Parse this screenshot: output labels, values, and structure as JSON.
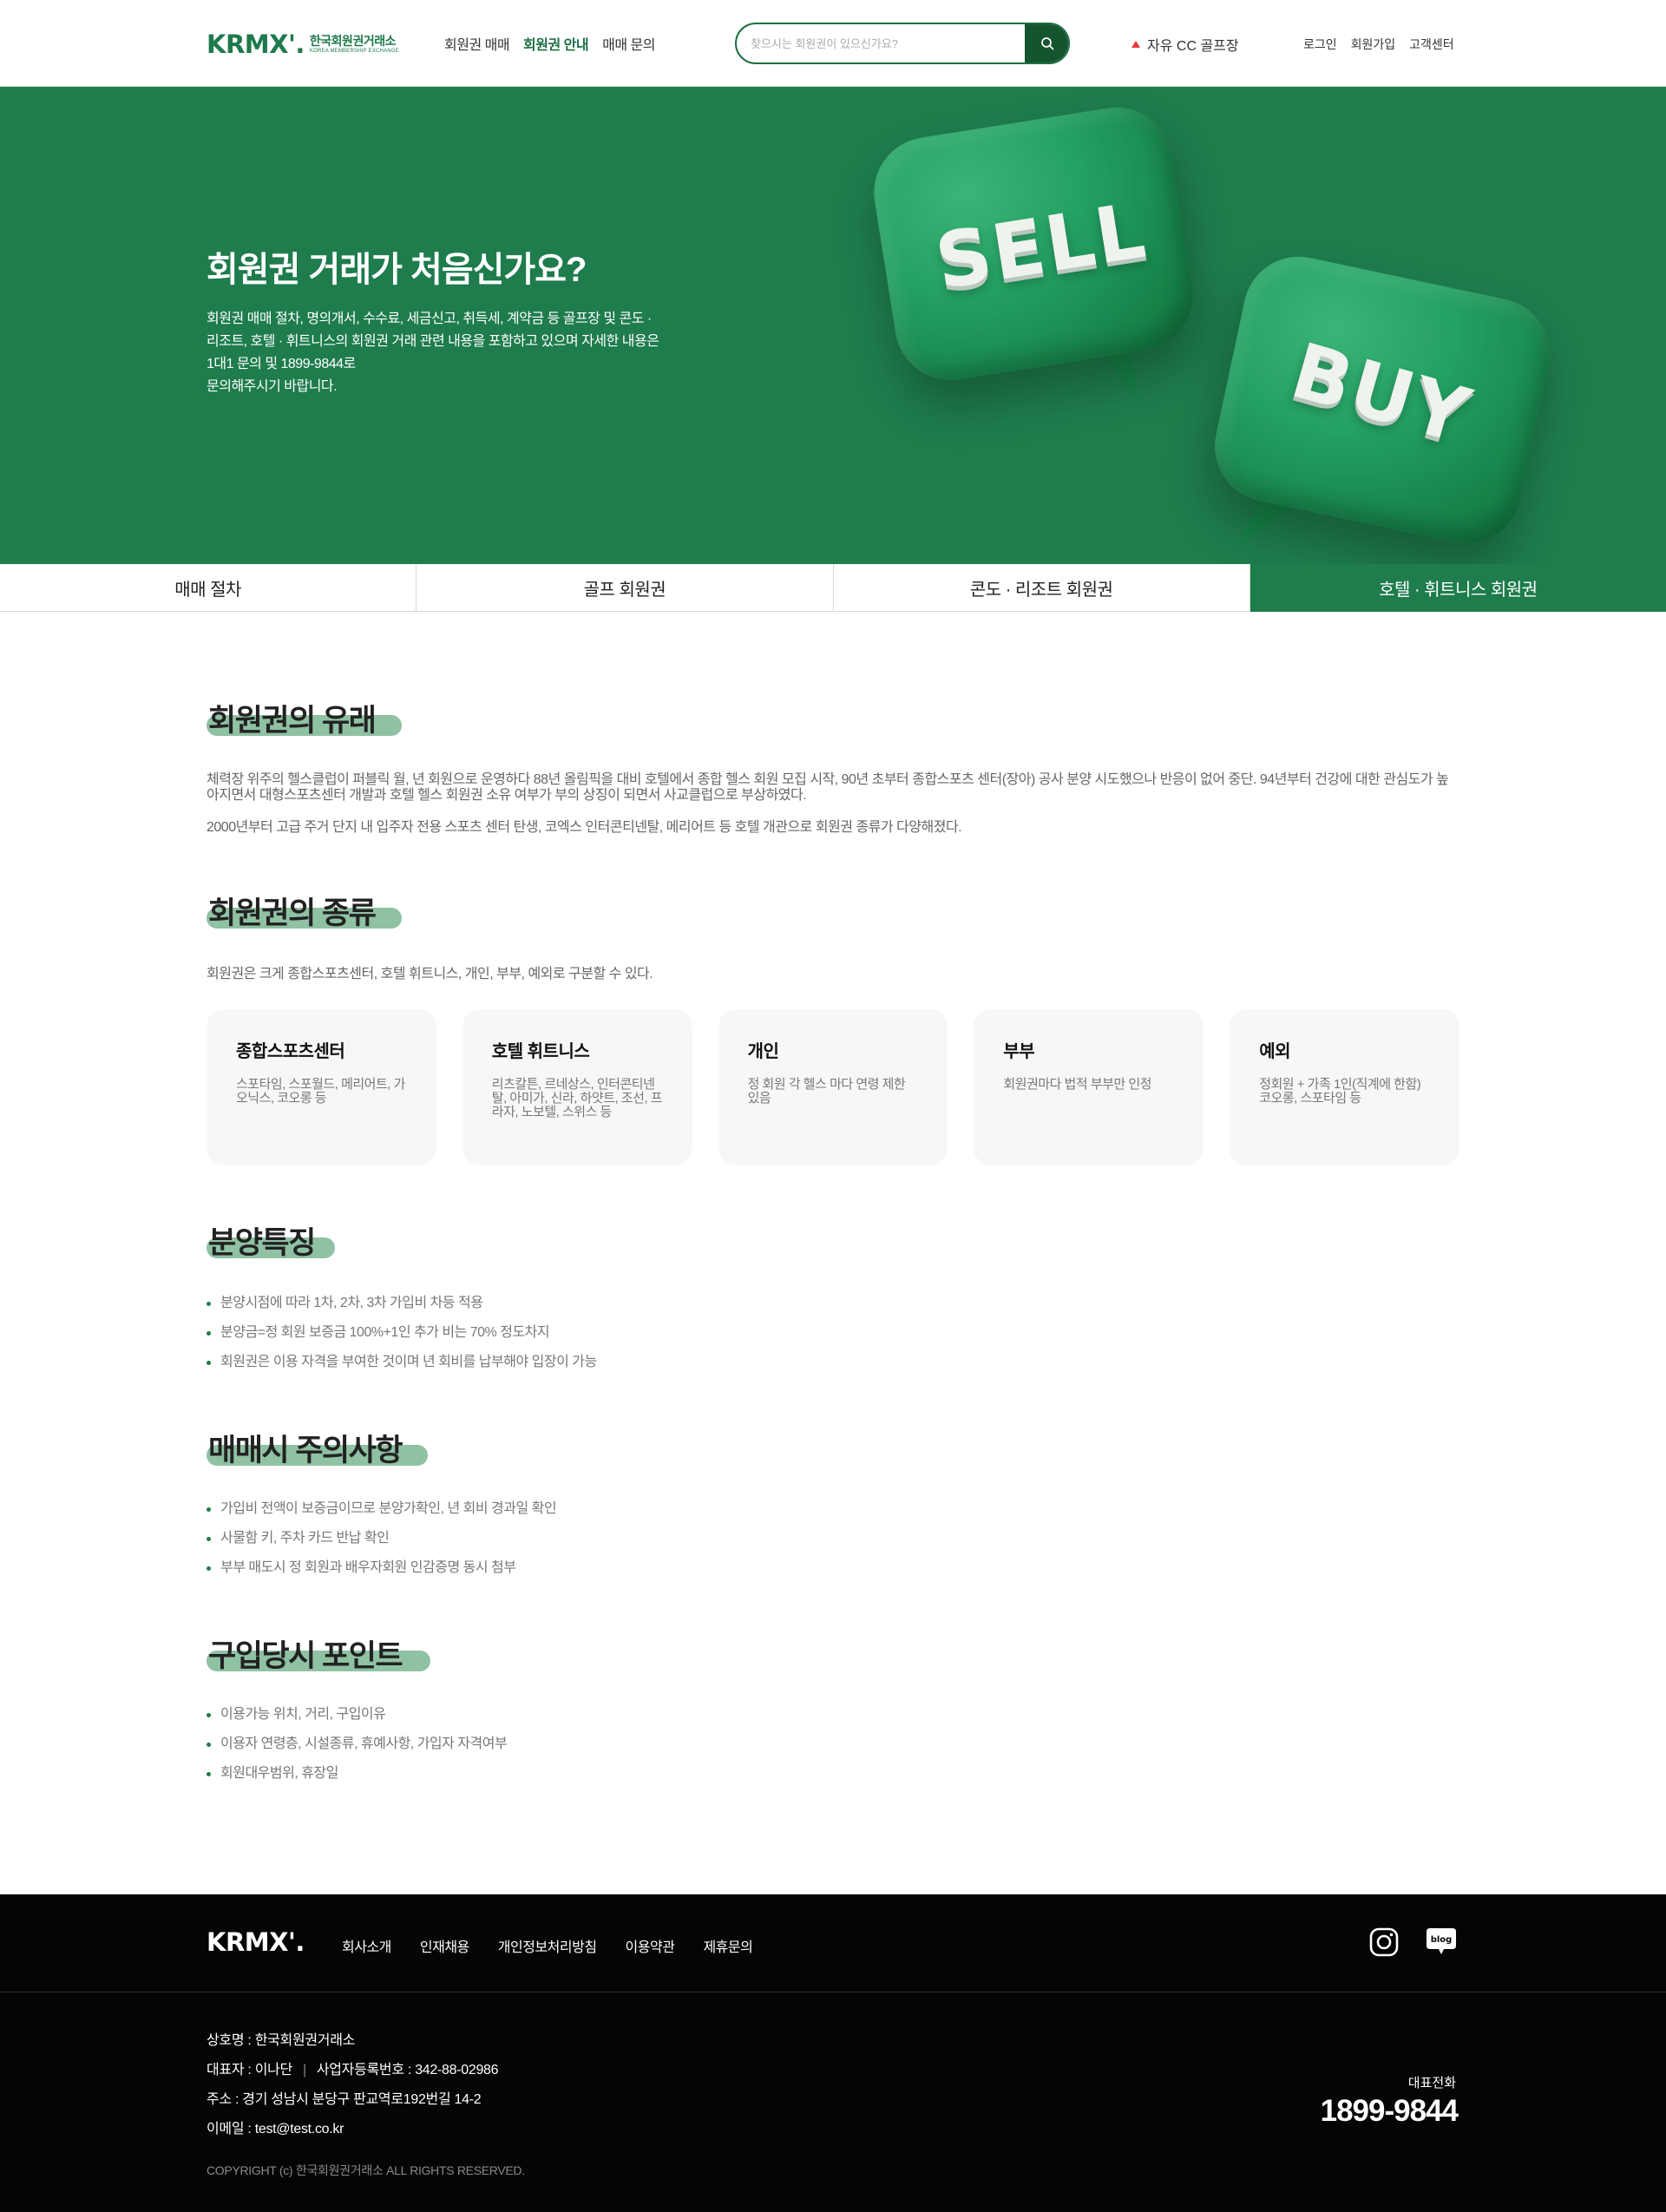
{
  "header": {
    "logo_mark": "KRMX'.",
    "logo_ko": "한국회원권거래소",
    "logo_en": "KOREA MEMBERSHIP EXCHANGE",
    "nav": [
      {
        "label": "회원권 매매"
      },
      {
        "label": "회원권 안내"
      },
      {
        "label": "매매 문의"
      }
    ],
    "active_nav": "회원권 안내",
    "search_placeholder": "찾으시는 회원권이 있으신가요?",
    "ticker": "자유 CC 골프장",
    "util": [
      "로그인",
      "회원가입",
      "고객센터"
    ]
  },
  "hero": {
    "title": "회원권 거래가 처음신가요?",
    "desc": [
      "회원권 매매 절차, 명의개서, 수수료, 세금신고, 취득세, 계약금 등 골프장 및 콘도 ·",
      "리조트, 호텔 · 휘트니스의 회원권 거래 관련 내용을 포함하고 있으며 자세한 내용은",
      "1대1 문의 및 1899-9844로",
      "문의해주시기 바랍니다."
    ],
    "sell_word": "SELL",
    "buy_word": "BUY"
  },
  "tabs": [
    "매매 절차",
    "골프 회원권",
    "콘도 · 리조트 회원권",
    "호텔 · 휘트니스 회원권"
  ],
  "active_tab": "호텔 · 휘트니스 회원권",
  "origin": {
    "title": "회원권의 유래",
    "p1": "체력장 위주의 헬스클럽이 퍼블릭 월, 년 회원으로 운영하다 88년 올림픽을 대비 호텔에서 종합 헬스 회원 모집 시작, 90년 초부터 종합스포츠 센터(장아) 공사 분양 시도했으나 반응이 없어 중단. 94년부터 건강에 대한 관심도가 높아지면서 대형스포츠센터 개발과 호텔 헬스 회원권 소유 여부가 부의 상징이 되면서 사교클럽으로 부상하였다.",
    "p2": "2000년부터 고급 주거 단지 내 입주자 전용 스포츠 센터 탄생, 코엑스 인터콘티넨탈, 메리어트 등 호텔 개관으로 회원권 종류가 다양해졌다."
  },
  "types": {
    "title": "회원권의 종류",
    "intro": "회원권은 크게 종합스포츠센터, 호텔 휘트니스, 개인, 부부, 예외로 구분할 수 있다.",
    "cards": [
      {
        "title": "종합스포츠센터",
        "desc": "스포타임, 스포월드, 메리어트, 가오닉스, 코오롱 등"
      },
      {
        "title": "호텔 휘트니스",
        "desc": "리츠칼튼, 르네상스, 인터콘티넨탈, 아미가, 신라, 하얏트, 조선, 프라자, 노보텔, 스위스 등"
      },
      {
        "title": "개인",
        "desc": "정 회원 각 헬스 마다 연령 제한 있음"
      },
      {
        "title": "부부",
        "desc": "회원권마다 법적 부부만 인정"
      },
      {
        "title": "예외",
        "desc": "정회원 + 가족 1인(직계에 한함) 코오롱, 스포타임 등"
      }
    ]
  },
  "features": {
    "title": "분양특징",
    "items": [
      "분양시점에 따라 1차, 2차, 3차 가입비 차등 적용",
      "분양금=정 회원 보증금 100%+1인 추가 비는 70% 정도차지",
      "회원권은 이용 자격을 부여한 것이며 년 회비를 납부해야 입장이 가능"
    ]
  },
  "cautions": {
    "title": "매매시 주의사항",
    "items": [
      "가입비 전액이 보증금이므로 분양가확인, 년 회비 경과일 확인",
      "사물함 키, 주차 카드 반납 확인",
      "부부 매도시 정 회원과 배우자회원 인감증명 동시 첨부"
    ]
  },
  "points": {
    "title": "구입당시 포인트",
    "items": [
      "이용가능 위치, 거리, 구입이유",
      "이용자 연령층, 시설종류, 휴예사항, 가입자 자격여부",
      "회원대우범위, 휴장일"
    ]
  },
  "footer": {
    "logo": "KRMX'.",
    "nav": [
      "회사소개",
      "인재채용",
      "개인정보처리방침",
      "이용약관",
      "제휴문의"
    ],
    "company": "상호명 : 한국회원권거래소",
    "ceo": "대표자 : 이나단",
    "biz_no": "사업자등록번호 : 342-88-02986",
    "address": "주소 : 경기 성남시 분당구 판교역로192번길 14-2",
    "email": "이메일 : test@test.co.kr",
    "copyright": "COPYRIGHT (c) 한국회원권거래소 ALL RIGHTS RESERVED.",
    "phone_label": "대표전화",
    "phone": "1899-9844",
    "blog_label": "blog"
  },
  "colors": {
    "brand_green": "#1e7c4d",
    "dark_green": "#14552f",
    "highlight": "#8fc1a3",
    "ticker_up": "#e23a3a"
  }
}
